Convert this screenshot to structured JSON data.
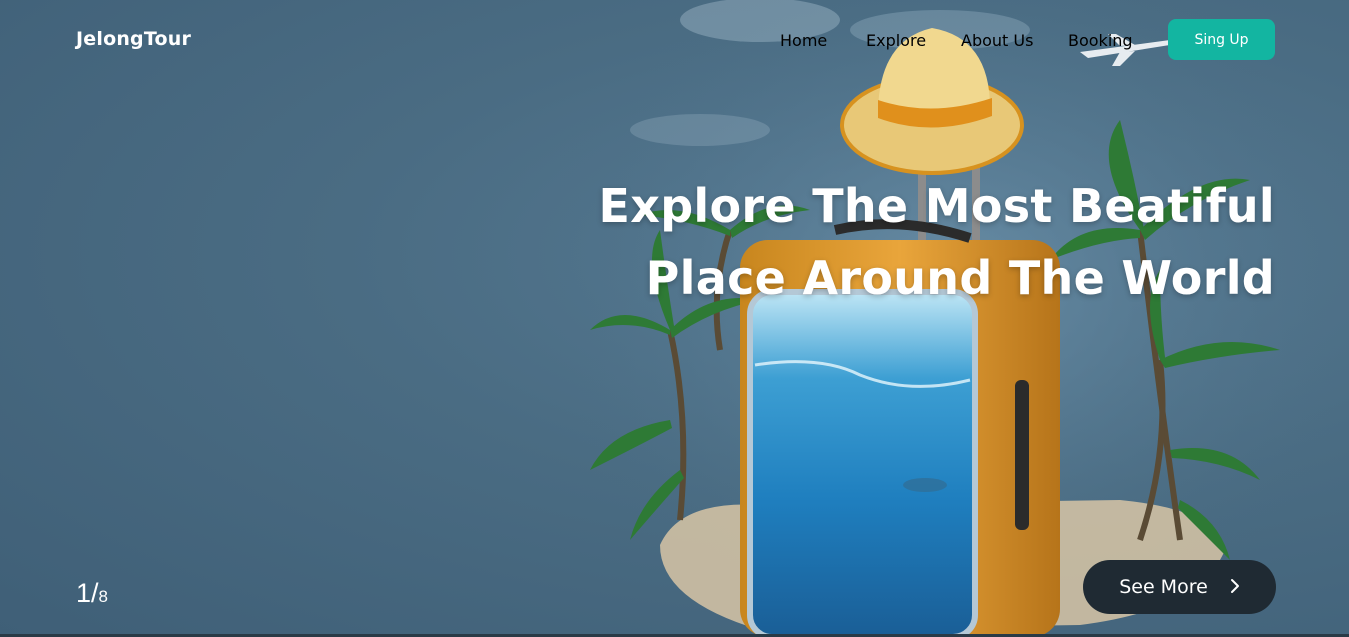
{
  "brand": {
    "name": "JelongTour"
  },
  "nav": {
    "items": [
      {
        "label": "Home",
        "active": true
      },
      {
        "label": "Explore",
        "active": false
      },
      {
        "label": "About Us",
        "active": false
      },
      {
        "label": "Booking",
        "active": false
      }
    ],
    "signup_label": "Sing Up"
  },
  "hero": {
    "headline_line1": "Explore The Most Beatiful",
    "headline_line2": "Place Around The World",
    "see_more_label": "See More",
    "see_more_icon": "chevron-right-icon"
  },
  "slider": {
    "current": "1",
    "separator": "/",
    "total": "8"
  },
  "colors": {
    "accent": "#13b5a1",
    "background": "#4a6c83",
    "see_more_bg": "#1f2a33",
    "text": "#ffffff"
  }
}
